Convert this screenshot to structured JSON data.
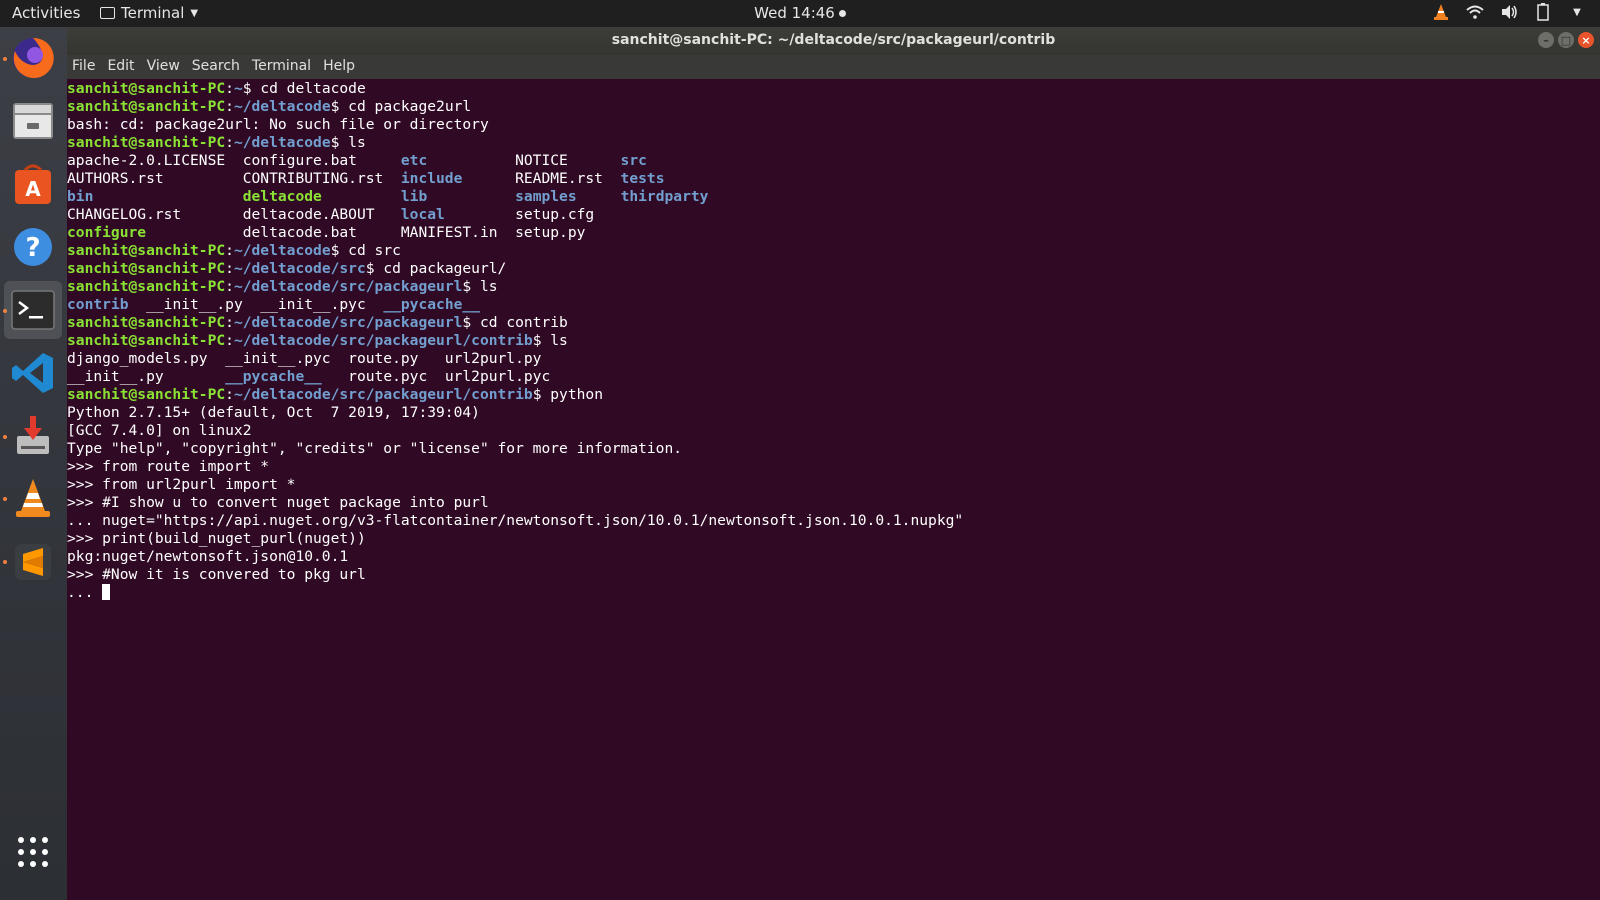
{
  "topbar": {
    "activities": "Activities",
    "app_menu": "Terminal",
    "clock": "Wed 14:46"
  },
  "dock": {
    "items": [
      {
        "name": "firefox-icon"
      },
      {
        "name": "files-icon"
      },
      {
        "name": "software-center-icon"
      },
      {
        "name": "help-icon"
      },
      {
        "name": "terminal-icon"
      },
      {
        "name": "vscode-icon"
      },
      {
        "name": "installer-icon"
      },
      {
        "name": "vlc-icon"
      },
      {
        "name": "sublime-icon"
      },
      {
        "name": "app-grid-icon"
      }
    ]
  },
  "window": {
    "title": "sanchit@sanchit-PC: ~/deltacode/src/packageurl/contrib",
    "menu": [
      "File",
      "Edit",
      "View",
      "Search",
      "Terminal",
      "Help"
    ]
  },
  "terminal": {
    "lines": [
      [
        {
          "t": "sanchit@sanchit-PC",
          "c": "u"
        },
        {
          "t": ":"
        },
        {
          "t": "~",
          "c": "p"
        },
        {
          "t": "$ cd deltacode"
        }
      ],
      [
        {
          "t": "sanchit@sanchit-PC",
          "c": "u"
        },
        {
          "t": ":"
        },
        {
          "t": "~/deltacode",
          "c": "p"
        },
        {
          "t": "$ cd package2url"
        }
      ],
      [
        {
          "t": "bash: cd: package2url: No such file or directory"
        }
      ],
      [
        {
          "t": "sanchit@sanchit-PC",
          "c": "u"
        },
        {
          "t": ":"
        },
        {
          "t": "~/deltacode",
          "c": "p"
        },
        {
          "t": "$ ls"
        }
      ],
      [
        {
          "t": "apache-2.0.LICENSE  configure.bat     "
        },
        {
          "t": "etc",
          "c": "dir"
        },
        {
          "t": "          NOTICE      "
        },
        {
          "t": "src",
          "c": "dir"
        }
      ],
      [
        {
          "t": "AUTHORS.rst         CONTRIBUTING.rst  "
        },
        {
          "t": "include",
          "c": "dir"
        },
        {
          "t": "      README.rst  "
        },
        {
          "t": "tests",
          "c": "dir"
        }
      ],
      [
        {
          "t": "bin",
          "c": "dir"
        },
        {
          "t": "                 "
        },
        {
          "t": "deltacode",
          "c": "exe"
        },
        {
          "t": "         "
        },
        {
          "t": "lib",
          "c": "dir"
        },
        {
          "t": "          "
        },
        {
          "t": "samples",
          "c": "dir"
        },
        {
          "t": "     "
        },
        {
          "t": "thirdparty",
          "c": "dir"
        }
      ],
      [
        {
          "t": "CHANGELOG.rst       deltacode.ABOUT   "
        },
        {
          "t": "local",
          "c": "dir"
        },
        {
          "t": "        setup.cfg"
        }
      ],
      [
        {
          "t": "configure",
          "c": "exe"
        },
        {
          "t": "           deltacode.bat     MANIFEST.in  setup.py"
        }
      ],
      [
        {
          "t": "sanchit@sanchit-PC",
          "c": "u"
        },
        {
          "t": ":"
        },
        {
          "t": "~/deltacode",
          "c": "p"
        },
        {
          "t": "$ cd src"
        }
      ],
      [
        {
          "t": "sanchit@sanchit-PC",
          "c": "u"
        },
        {
          "t": ":"
        },
        {
          "t": "~/deltacode/src",
          "c": "p"
        },
        {
          "t": "$ cd packageurl/"
        }
      ],
      [
        {
          "t": "sanchit@sanchit-PC",
          "c": "u"
        },
        {
          "t": ":"
        },
        {
          "t": "~/deltacode/src/packageurl",
          "c": "p"
        },
        {
          "t": "$ ls"
        }
      ],
      [
        {
          "t": "contrib",
          "c": "dir"
        },
        {
          "t": "  __init__.py  __init__.pyc  "
        },
        {
          "t": "__pycache__",
          "c": "dir"
        }
      ],
      [
        {
          "t": "sanchit@sanchit-PC",
          "c": "u"
        },
        {
          "t": ":"
        },
        {
          "t": "~/deltacode/src/packageurl",
          "c": "p"
        },
        {
          "t": "$ cd contrib"
        }
      ],
      [
        {
          "t": "sanchit@sanchit-PC",
          "c": "u"
        },
        {
          "t": ":"
        },
        {
          "t": "~/deltacode/src/packageurl/contrib",
          "c": "p"
        },
        {
          "t": "$ ls"
        }
      ],
      [
        {
          "t": "django_models.py  __init__.pyc  route.py   url2purl.py"
        }
      ],
      [
        {
          "t": "__init__.py       "
        },
        {
          "t": "__pycache__",
          "c": "dir"
        },
        {
          "t": "   route.pyc  url2purl.pyc"
        }
      ],
      [
        {
          "t": "sanchit@sanchit-PC",
          "c": "u"
        },
        {
          "t": ":"
        },
        {
          "t": "~/deltacode/src/packageurl/contrib",
          "c": "p"
        },
        {
          "t": "$ python"
        }
      ],
      [
        {
          "t": "Python 2.7.15+ (default, Oct  7 2019, 17:39:04)"
        }
      ],
      [
        {
          "t": "[GCC 7.4.0] on linux2"
        }
      ],
      [
        {
          "t": "Type \"help\", \"copyright\", \"credits\" or \"license\" for more information."
        }
      ],
      [
        {
          "t": ">>> from route import *"
        }
      ],
      [
        {
          "t": ">>> from url2purl import *"
        }
      ],
      [
        {
          "t": ">>> #I show u to convert nuget package into purl"
        }
      ],
      [
        {
          "t": "... nuget=\"https://api.nuget.org/v3-flatcontainer/newtonsoft.json/10.0.1/newtonsoft.json.10.0.1.nupkg\""
        }
      ],
      [
        {
          "t": ">>> print(build_nuget_purl(nuget))"
        }
      ],
      [
        {
          "t": "pkg:nuget/newtonsoft.json@10.0.1"
        }
      ],
      [
        {
          "t": ">>> #Now it is convered to pkg url"
        }
      ],
      [
        {
          "t": "... "
        }
      ]
    ],
    "colors": {
      "background": "#300a24",
      "user": "#8ae234",
      "path": "#729fcf"
    }
  }
}
